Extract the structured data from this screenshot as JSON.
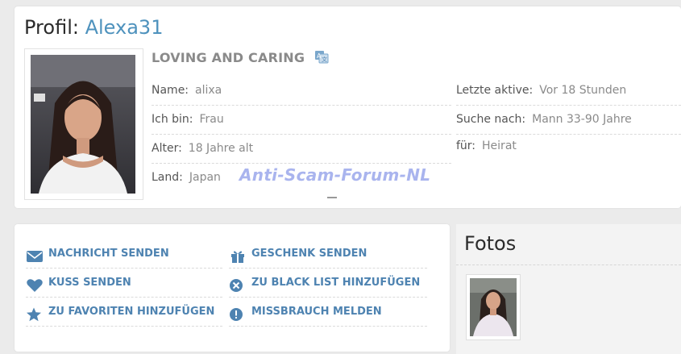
{
  "profile": {
    "title_prefix": "Profil:",
    "username": "Alexa31",
    "headline": "LOVING AND CARING",
    "fields": {
      "name_label": "Name:",
      "name_value": "alixa",
      "iam_label": "Ich bin:",
      "iam_value": "Frau",
      "age_label": "Alter:",
      "age_value": "18 Jahre alt",
      "country_label": "Land:",
      "country_value": "Japan",
      "lastactive_label": "Letzte aktive:",
      "lastactive_value": "Vor 18 Stunden",
      "seeking_label": "Suche nach:",
      "seeking_value": "Mann 33-90 Jahre",
      "for_label": "für:",
      "for_value": "Heirat"
    },
    "watermark": "Anti-Scam-Forum-NL"
  },
  "actions": {
    "send_message": "NACHRICHT SENDEN",
    "send_gift": "GESCHENK SENDEN",
    "send_kiss": "KUSS SENDEN",
    "add_blacklist": "ZU BLACK LIST HINZUFÜGEN",
    "add_favorites": "ZU FAVORITEN HINZUFÜGEN",
    "report_abuse": "MISSBRAUCH MELDEN"
  },
  "photos": {
    "title": "Fotos"
  },
  "colors": {
    "accent": "#4e92bd",
    "link": "#4e83b1",
    "watermark": "#a9b4ee"
  },
  "icons": [
    "translate-icon",
    "envelope-icon",
    "gift-icon",
    "heart-icon",
    "times-circle-icon",
    "star-icon",
    "exclamation-circle-icon"
  ]
}
